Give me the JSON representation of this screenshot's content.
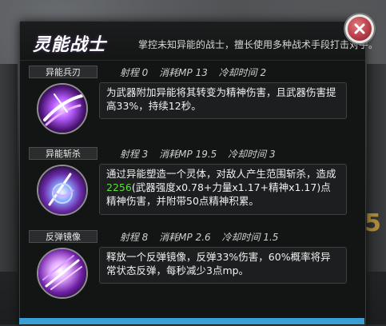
{
  "panel": {
    "title": "灵能战士",
    "subtitle": "掌控未知异能的战士，擅长使用多种战术手段打击对手。"
  },
  "background": {
    "number": "5"
  },
  "skills": [
    {
      "name": "异能兵刃",
      "range_label": "射程",
      "range": "0",
      "mp_label": "消耗MP",
      "mp": "13",
      "cd_label": "冷却时间",
      "cd": "2",
      "desc_parts": [
        "为武器附加异能将其转变为精神伤害，且武器伤害提高33%，持续12秒。"
      ],
      "icon": "purple-blade-slash-icon"
    },
    {
      "name": "异能斩杀",
      "range_label": "射程",
      "range": "3",
      "mp_label": "消耗MP",
      "mp": "19.5",
      "cd_label": "冷却时间",
      "cd": "3",
      "desc_pre": "通过异能塑造一个灵体，对敌人产生范围斩杀，造成",
      "desc_highlight": "2256",
      "desc_post": "(武器强度x0.78+力量x1.17+精神x1.17)点精神伤害，并附带50点精神积累。",
      "icon": "spirit-execution-icon"
    },
    {
      "name": "反弹镜像",
      "range_label": "射程",
      "range": "8",
      "mp_label": "消耗MP",
      "mp": "2.6",
      "cd_label": "冷却时间",
      "cd": "1.5",
      "desc_parts": [
        "释放一个反弹镜像，反弹33%伤害，60%概率将异常状态反弹，每秒减少3点mp。"
      ],
      "icon": "reflect-mirror-icon"
    }
  ],
  "colors": {
    "highlight": "#5fdc3c",
    "accent_purple": "#b06bff",
    "close_red": "#b6404a"
  }
}
